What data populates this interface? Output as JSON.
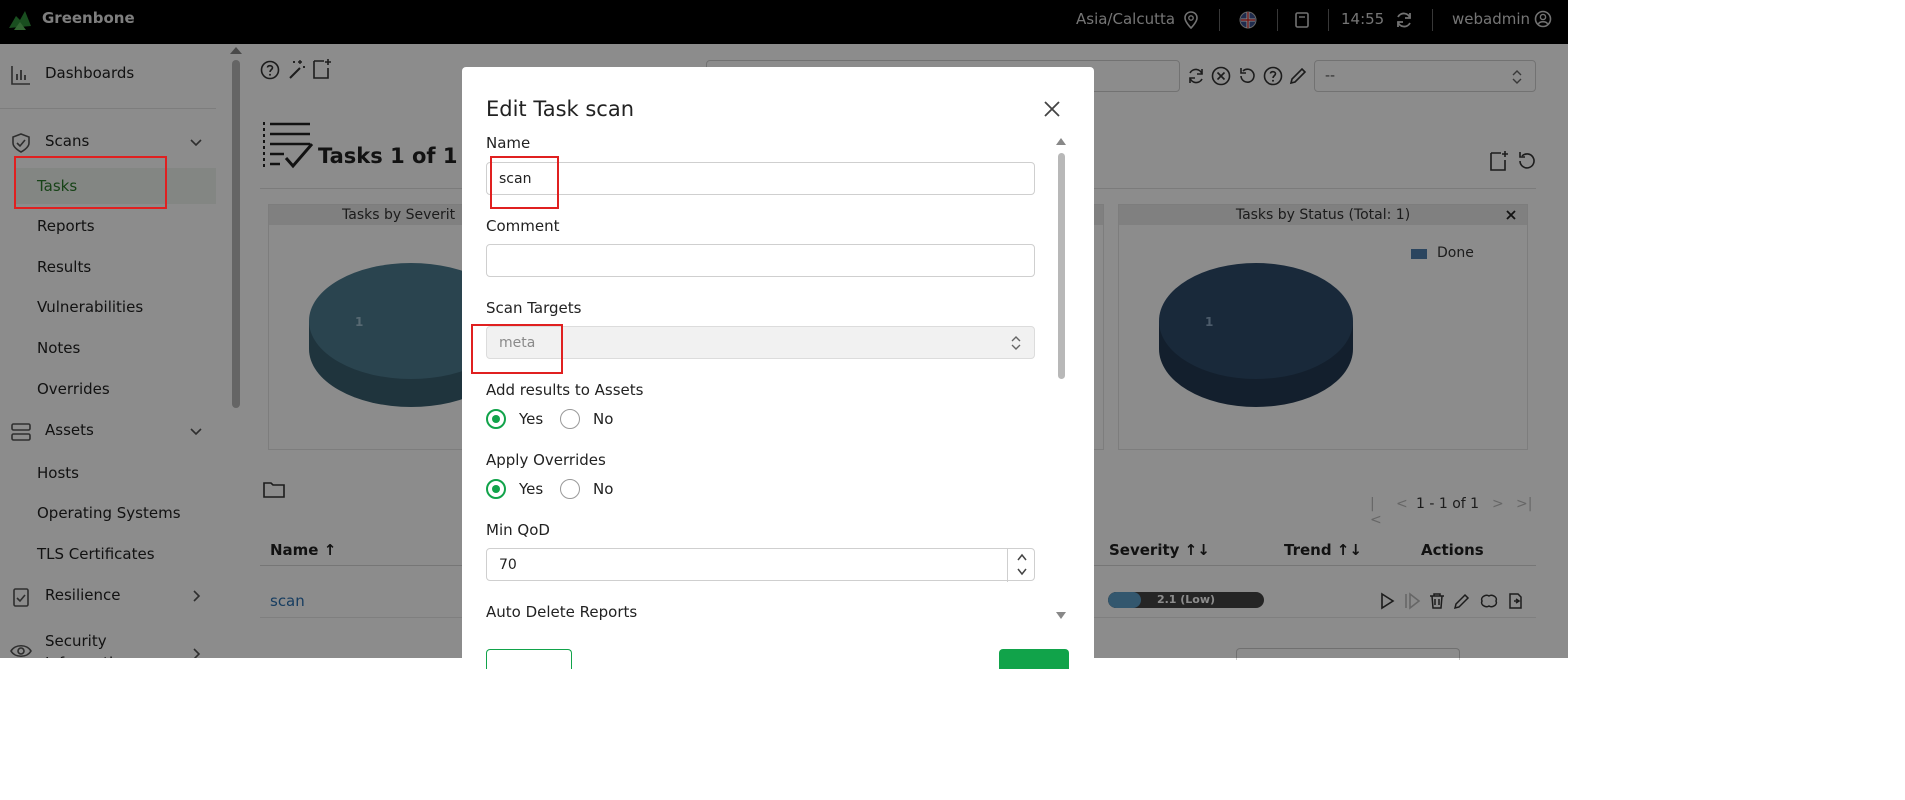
{
  "app": {
    "brand": "Greenbone"
  },
  "topbar": {
    "timezone": "Asia/Calcutta",
    "time": "14:55",
    "user": "webadmin"
  },
  "sidebar": {
    "dashboards": "Dashboards",
    "scans": {
      "label": "Scans",
      "items": [
        "Tasks",
        "Reports",
        "Results",
        "Vulnerabilities",
        "Notes",
        "Overrides"
      ]
    },
    "assets": {
      "label": "Assets",
      "items": [
        "Hosts",
        "Operating Systems",
        "TLS Certificates"
      ]
    },
    "resilience": "Resilience",
    "security_information": "Security Information"
  },
  "main": {
    "filter_select": "--",
    "page_title": "Tasks 1 of 1",
    "chart_left_title": "Tasks by Severit",
    "chart_left_value": "1",
    "chart_right_title": "Tasks by Status (Total: 1)",
    "chart_right_value": "1",
    "chart_right_legend": "Done",
    "pagination": "1 - 1 of 1",
    "table_headers": {
      "name": "Name ↑",
      "severity": "Severity ↑↓",
      "trend": "Trend ↑↓",
      "actions": "Actions"
    },
    "row": {
      "name": "scan",
      "severity_label": "2.1 (Low)",
      "severity_fraction": 0.21
    }
  },
  "dialog": {
    "title": "Edit Task scan",
    "name_label": "Name",
    "name_value": "scan",
    "comment_label": "Comment",
    "comment_value": "",
    "targets_label": "Scan Targets",
    "targets_value": "meta",
    "add_assets_label": "Add results to Assets",
    "apply_overrides_label": "Apply Overrides",
    "yes": "Yes",
    "no": "No",
    "min_qod_label": "Min QoD",
    "min_qod_value": "70",
    "auto_delete_label": "Auto Delete Reports"
  },
  "colors": {
    "accent_green": "#11a34a",
    "link_blue": "#2a6fb0",
    "annotation_red": "#e02020",
    "pie_left": "#4d7c90",
    "pie_right": "#2f4c6b"
  }
}
